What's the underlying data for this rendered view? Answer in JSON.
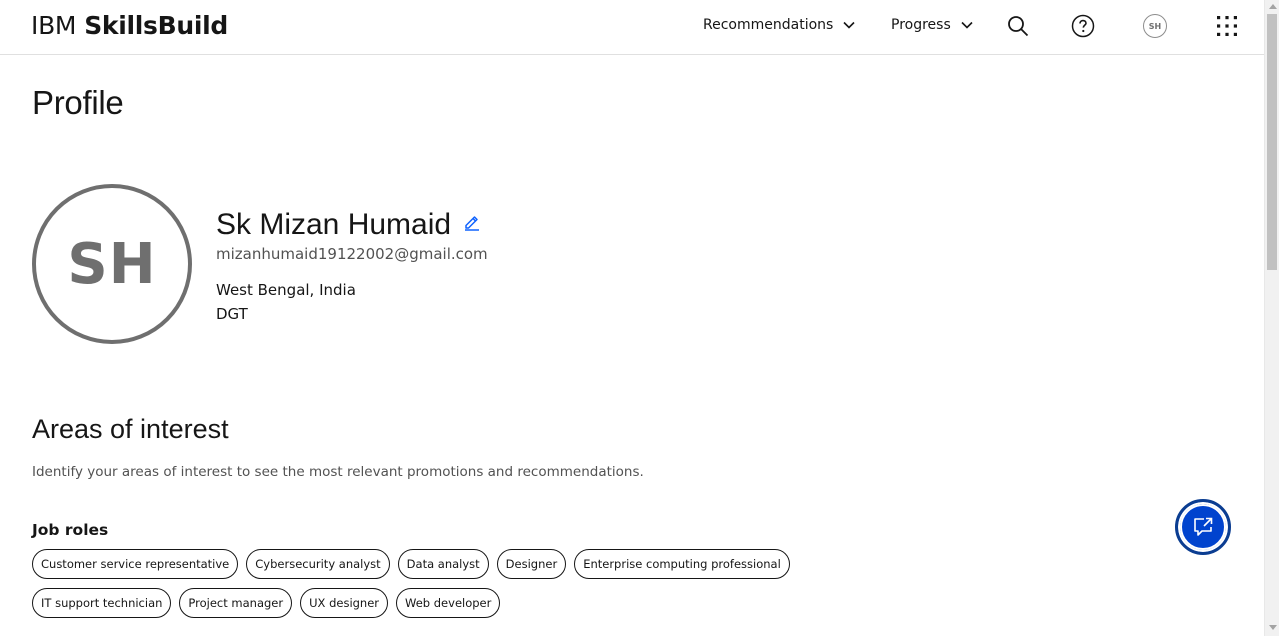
{
  "header": {
    "brand_prefix": "IBM",
    "brand_name": "SkillsBuild",
    "nav": [
      {
        "label": "Recommendations"
      },
      {
        "label": "Progress"
      }
    ],
    "avatar_initials": "SH",
    "icons": [
      "search-icon",
      "help-icon",
      "avatar",
      "app-switcher-icon"
    ]
  },
  "page": {
    "title": "Profile"
  },
  "profile": {
    "initials": "SH",
    "name": "Sk Mizan Humaid",
    "email": "mizanhumaid19122002@gmail.com",
    "location": "West Bengal, India",
    "organization": "DGT"
  },
  "interests": {
    "title": "Areas of interest",
    "description": "Identify your areas of interest to see the most relevant promotions and recommendations.",
    "job_roles_heading": "Job roles",
    "job_roles": [
      "Customer service representative",
      "Cybersecurity analyst",
      "Data analyst",
      "Designer",
      "Enterprise computing professional",
      "IT support technician",
      "Project manager",
      "UX designer",
      "Web developer"
    ]
  },
  "colors": {
    "accent": "#0f62fe",
    "fab": "#0043ce",
    "text_primary": "#161616",
    "text_secondary": "#525252",
    "avatar_gray": "#6f6f6f"
  }
}
